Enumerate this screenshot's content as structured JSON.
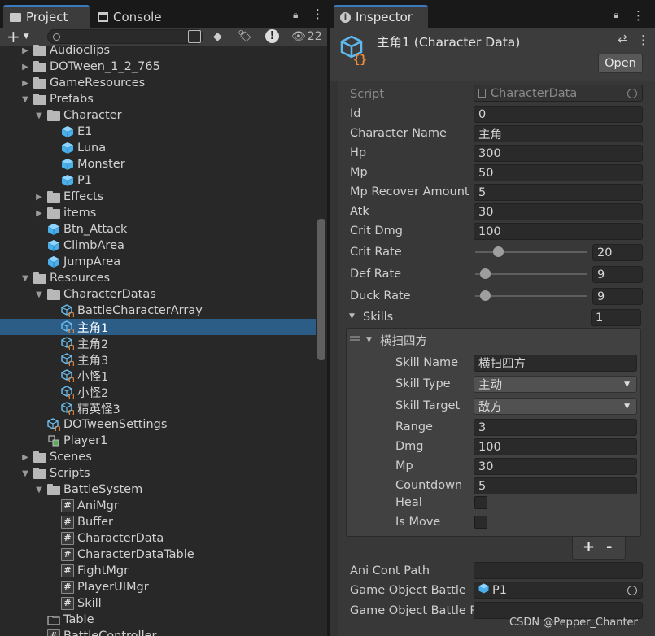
{
  "left_tabs": [
    {
      "label": "Project",
      "icon": "folder-icon"
    },
    {
      "label": "Console",
      "icon": "console-icon"
    }
  ],
  "search": {
    "placeholder": "",
    "hidden_count": "22"
  },
  "tree": [
    {
      "label": "Audioclips",
      "icon": "folder",
      "depth": 1,
      "arrow": "collapsed"
    },
    {
      "label": "DOTween_1_2_765",
      "icon": "folder",
      "depth": 1,
      "arrow": "collapsed"
    },
    {
      "label": "GameResources",
      "icon": "folder",
      "depth": 1,
      "arrow": "collapsed"
    },
    {
      "label": "Prefabs",
      "icon": "folder-open",
      "depth": 1,
      "arrow": "expanded"
    },
    {
      "label": "Character",
      "icon": "folder-open",
      "depth": 2,
      "arrow": "expanded"
    },
    {
      "label": "E1",
      "icon": "prefab",
      "depth": 3,
      "arrow": "none"
    },
    {
      "label": "Luna",
      "icon": "prefab",
      "depth": 3,
      "arrow": "none"
    },
    {
      "label": "Monster",
      "icon": "prefab",
      "depth": 3,
      "arrow": "none"
    },
    {
      "label": "P1",
      "icon": "prefab",
      "depth": 3,
      "arrow": "none"
    },
    {
      "label": "Effects",
      "icon": "folder",
      "depth": 2,
      "arrow": "collapsed"
    },
    {
      "label": "items",
      "icon": "folder",
      "depth": 2,
      "arrow": "collapsed"
    },
    {
      "label": "Btn_Attack",
      "icon": "prefab",
      "depth": 2,
      "arrow": "none"
    },
    {
      "label": "ClimbArea",
      "icon": "prefab",
      "depth": 2,
      "arrow": "none"
    },
    {
      "label": "JumpArea",
      "icon": "prefab",
      "depth": 2,
      "arrow": "none"
    },
    {
      "label": "Resources",
      "icon": "folder-open",
      "depth": 1,
      "arrow": "expanded"
    },
    {
      "label": "CharacterDatas",
      "icon": "folder-open",
      "depth": 2,
      "arrow": "expanded"
    },
    {
      "label": "BattleCharacterArray",
      "icon": "scriptable",
      "depth": 3,
      "arrow": "none"
    },
    {
      "label": "主角1",
      "icon": "scriptable",
      "depth": 3,
      "arrow": "none",
      "selected": true
    },
    {
      "label": "主角2",
      "icon": "scriptable",
      "depth": 3,
      "arrow": "none"
    },
    {
      "label": "主角3",
      "icon": "scriptable",
      "depth": 3,
      "arrow": "none"
    },
    {
      "label": "小怪1",
      "icon": "scriptable",
      "depth": 3,
      "arrow": "none"
    },
    {
      "label": "小怪2",
      "icon": "scriptable",
      "depth": 3,
      "arrow": "none"
    },
    {
      "label": "精英怪3",
      "icon": "scriptable",
      "depth": 3,
      "arrow": "none"
    },
    {
      "label": "DOTweenSettings",
      "icon": "scriptable",
      "depth": 2,
      "arrow": "none"
    },
    {
      "label": "Player1",
      "icon": "player",
      "depth": 2,
      "arrow": "none"
    },
    {
      "label": "Scenes",
      "icon": "folder",
      "depth": 1,
      "arrow": "collapsed"
    },
    {
      "label": "Scripts",
      "icon": "folder-open",
      "depth": 1,
      "arrow": "expanded"
    },
    {
      "label": "BattleSystem",
      "icon": "folder-open",
      "depth": 2,
      "arrow": "expanded"
    },
    {
      "label": "AniMgr",
      "icon": "script",
      "depth": 3,
      "arrow": "none"
    },
    {
      "label": "Buffer",
      "icon": "script",
      "depth": 3,
      "arrow": "none"
    },
    {
      "label": "CharacterData",
      "icon": "script",
      "depth": 3,
      "arrow": "none"
    },
    {
      "label": "CharacterDataTable",
      "icon": "script",
      "depth": 3,
      "arrow": "none"
    },
    {
      "label": "FightMgr",
      "icon": "script",
      "depth": 3,
      "arrow": "none"
    },
    {
      "label": "PlayerUIMgr",
      "icon": "script",
      "depth": 3,
      "arrow": "none"
    },
    {
      "label": "Skill",
      "icon": "script",
      "depth": 3,
      "arrow": "none"
    },
    {
      "label": "Table",
      "icon": "folder-outline",
      "depth": 2,
      "arrow": "none"
    },
    {
      "label": "BattleController",
      "icon": "script",
      "depth": 2,
      "arrow": "none"
    }
  ],
  "inspector": {
    "tab": "Inspector",
    "title": "主角1 (Character Data)",
    "open_button": "Open",
    "script_label": "Script",
    "script_value": "CharacterData",
    "fields": [
      {
        "label": "Id",
        "value": "0"
      },
      {
        "label": "Character Name",
        "value": "主角"
      },
      {
        "label": "Hp",
        "value": "300"
      },
      {
        "label": "Mp",
        "value": "50"
      },
      {
        "label": "Mp Recover Amount",
        "value": "5"
      },
      {
        "label": "Atk",
        "value": "30"
      },
      {
        "label": "Crit Dmg",
        "value": "100"
      }
    ],
    "sliders": [
      {
        "label": "Crit Rate",
        "value": "20",
        "fraction": 0.2
      },
      {
        "label": "Def Rate",
        "value": "9",
        "fraction": 0.09
      },
      {
        "label": "Duck Rate",
        "value": "9",
        "fraction": 0.09
      }
    ],
    "skills_label": "Skills",
    "skills_count": "1",
    "skill": {
      "header": "横扫四方",
      "fields": [
        {
          "label": "Skill Name",
          "value": "横扫四方",
          "kind": "text"
        },
        {
          "label": "Skill Type",
          "value": "主动",
          "kind": "dropdown"
        },
        {
          "label": "Skill Target",
          "value": "敌方",
          "kind": "dropdown"
        },
        {
          "label": "Range",
          "value": "3",
          "kind": "text"
        },
        {
          "label": "Dmg",
          "value": "100",
          "kind": "text"
        },
        {
          "label": "Mp",
          "value": "30",
          "kind": "text"
        },
        {
          "label": "Countdown",
          "value": "5",
          "kind": "text"
        }
      ],
      "checks": [
        {
          "label": "Heal",
          "checked": false
        },
        {
          "label": "Is Move",
          "checked": false
        }
      ]
    },
    "add_label": "+",
    "remove_label": "-",
    "ani_cont_path_label": "Ani Cont Path",
    "ani_cont_path_value": "",
    "gob_label": "Game Object Battle",
    "gob_value": "P1",
    "gobp_label": "Game Object Battle P",
    "gobp_value": ""
  },
  "watermark": "CSDN @Pepper_Chanter"
}
